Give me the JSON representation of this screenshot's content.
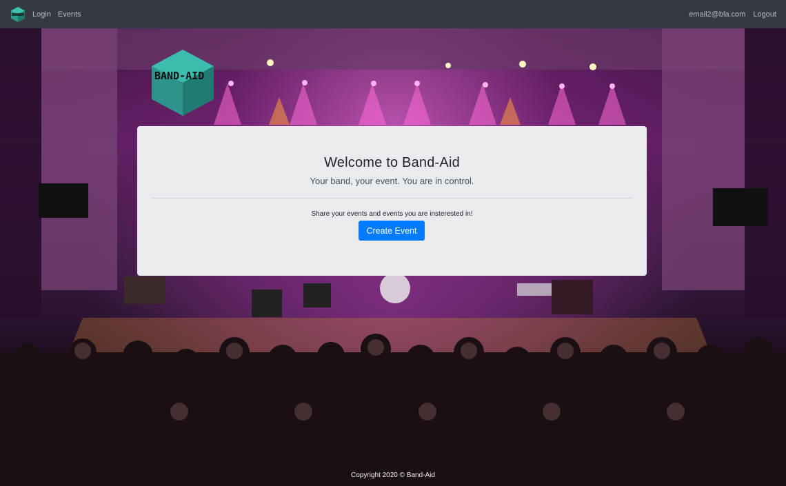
{
  "nav": {
    "brand_logo_icon": "band-aid-hexagon-icon",
    "links": [
      {
        "label": "Login"
      },
      {
        "label": "Events"
      }
    ],
    "user_email": "email2@bla.com",
    "logout_label": "Logout"
  },
  "hero": {
    "logo_text": "BAND-AID",
    "title": "Welcome to Band-Aid",
    "subtitle": "Your band, your event. You are in control.",
    "share_text": "Share your events and events you are insterested in!",
    "cta_label": "Create Event"
  },
  "footer": {
    "copyright": "Copyright 2020 © Band-Aid"
  },
  "colors": {
    "navbar": "#343a40",
    "jumbotron": "#e9ecef",
    "primary": "#007bff",
    "logo_teal": "#2a9d8f"
  }
}
